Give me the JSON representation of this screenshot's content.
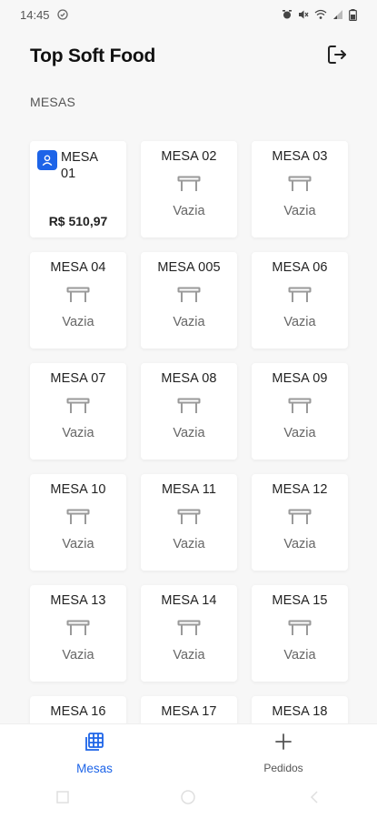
{
  "status_bar": {
    "time": "14:45",
    "icons": [
      "shield-check-icon",
      "alarm-icon",
      "mute-icon",
      "wifi-icon",
      "signal-icon",
      "battery-icon"
    ]
  },
  "header": {
    "title": "Top Soft Food",
    "logout_icon": "logout-icon"
  },
  "section": {
    "label": "MESAS"
  },
  "tables": [
    {
      "name": "MESA 01",
      "status": "",
      "amount": "R$ 510,97",
      "occupied": true
    },
    {
      "name": "MESA 02",
      "status": "Vazia"
    },
    {
      "name": "MESA 03",
      "status": "Vazia"
    },
    {
      "name": "MESA 04",
      "status": "Vazia"
    },
    {
      "name": "MESA 005",
      "status": "Vazia"
    },
    {
      "name": "MESA 06",
      "status": "Vazia"
    },
    {
      "name": "MESA 07",
      "status": "Vazia"
    },
    {
      "name": "MESA 08",
      "status": "Vazia"
    },
    {
      "name": "MESA 09",
      "status": "Vazia"
    },
    {
      "name": "MESA 10",
      "status": "Vazia"
    },
    {
      "name": "MESA 11",
      "status": "Vazia"
    },
    {
      "name": "MESA 12",
      "status": "Vazia"
    },
    {
      "name": "MESA 13",
      "status": "Vazia"
    },
    {
      "name": "MESA 14",
      "status": "Vazia"
    },
    {
      "name": "MESA 15",
      "status": "Vazia"
    },
    {
      "name": "MESA 16",
      "status": ""
    },
    {
      "name": "MESA 17",
      "status": ""
    },
    {
      "name": "MESA 18",
      "status": ""
    }
  ],
  "bottom_nav": {
    "mesas": "Mesas",
    "pedidos": "Pedidos"
  },
  "colors": {
    "accent": "#1d64e8",
    "background": "#f7f7f7",
    "card": "#ffffff"
  }
}
